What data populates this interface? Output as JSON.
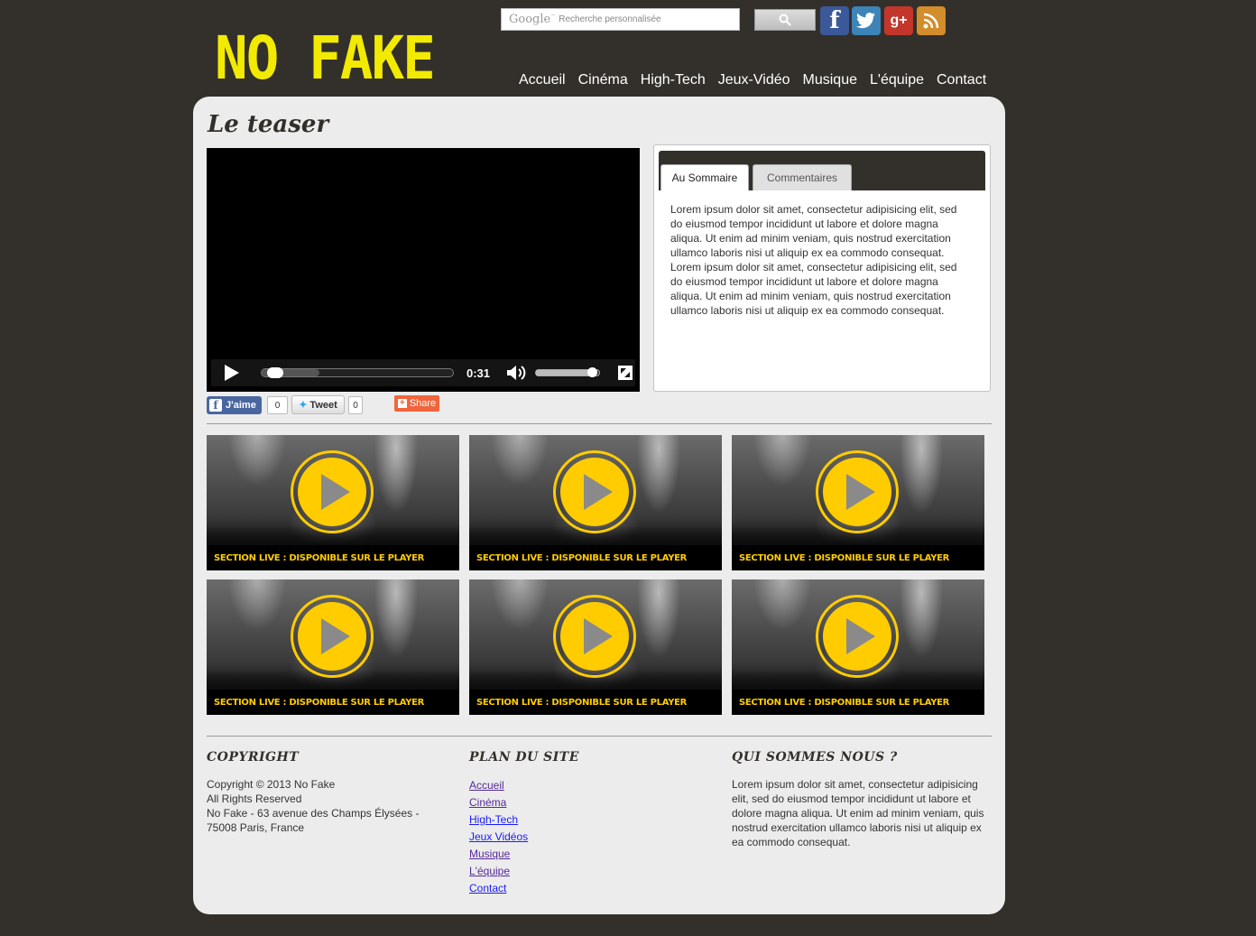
{
  "brand": {
    "logo_text": "NO FAKE",
    "accent": "#f2ea00",
    "bg": "#33302b"
  },
  "search": {
    "google_label": "Google",
    "tm": "™",
    "placeholder": "Recherche personnalisée"
  },
  "social": [
    {
      "name": "facebook",
      "glyph": "f"
    },
    {
      "name": "twitter",
      "glyph": "t"
    },
    {
      "name": "google-plus",
      "glyph": "g+"
    },
    {
      "name": "rss",
      "glyph": ""
    }
  ],
  "nav": [
    "Accueil",
    "Cinéma",
    "High-Tech",
    "Jeux-Vidéo",
    "Musique",
    "L'équipe",
    "Contact"
  ],
  "page_title": "Le teaser",
  "player": {
    "time": "0:31",
    "progress_fraction": 0.03,
    "buffered_fraction": 0.3,
    "volume_fraction": 0.9
  },
  "share": {
    "like_label": "J'aime",
    "like_count": "0",
    "tweet_label": "Tweet",
    "tweet_count": "0",
    "share_label": "Share"
  },
  "tabs": {
    "items": [
      "Au Sommaire",
      "Commentaires"
    ],
    "active": 0,
    "content": "Lorem ipsum dolor sit amet, consectetur adipisicing elit, sed do eiusmod tempor incididunt ut labore et dolore magna aliqua. Ut enim ad minim veniam, quis nostrud exercitation ullamco laboris nisi ut aliquip ex ea commodo consequat. Lorem ipsum dolor sit amet, consectetur adipisicing elit, sed do eiusmod tempor incididunt ut labore et dolore magna aliqua. Ut enim ad minim veniam, quis nostrud exercitation ullamco laboris nisi ut aliquip ex ea commodo consequat."
  },
  "thumbnails": [
    {
      "caption": "SECTION LIVE : DISPONIBLE SUR LE PLAYER"
    },
    {
      "caption": "SECTION LIVE : DISPONIBLE SUR LE PLAYER"
    },
    {
      "caption": "SECTION LIVE : DISPONIBLE SUR LE PLAYER"
    },
    {
      "caption": "SECTION LIVE : DISPONIBLE SUR LE PLAYER"
    },
    {
      "caption": "SECTION LIVE : DISPONIBLE SUR LE PLAYER"
    },
    {
      "caption": "SECTION LIVE : DISPONIBLE SUR LE PLAYER"
    }
  ],
  "footer": {
    "copyright": {
      "title": "COPYRIGHT",
      "lines": [
        "Copyright © 2013 No Fake",
        "All Rights Reserved",
        "No Fake - 63 avenue des Champs Élysées - 75008 Paris, France"
      ]
    },
    "sitemap": {
      "title": "PLAN DU SITE",
      "links": [
        "Accueil",
        "Cinéma",
        "High-Tech",
        "Jeux Vidéos",
        "Musique",
        "L'équipe",
        "Contact"
      ]
    },
    "about": {
      "title": "QUI SOMMES NOUS ?",
      "text": "Lorem ipsum dolor sit amet, consectetur adipisicing elit, sed do eiusmod tempor incididunt ut labore et dolore magna aliqua. Ut enim ad minim veniam, quis nostrud exercitation ullamco laboris nisi ut aliquip ex ea commodo consequat."
    }
  }
}
